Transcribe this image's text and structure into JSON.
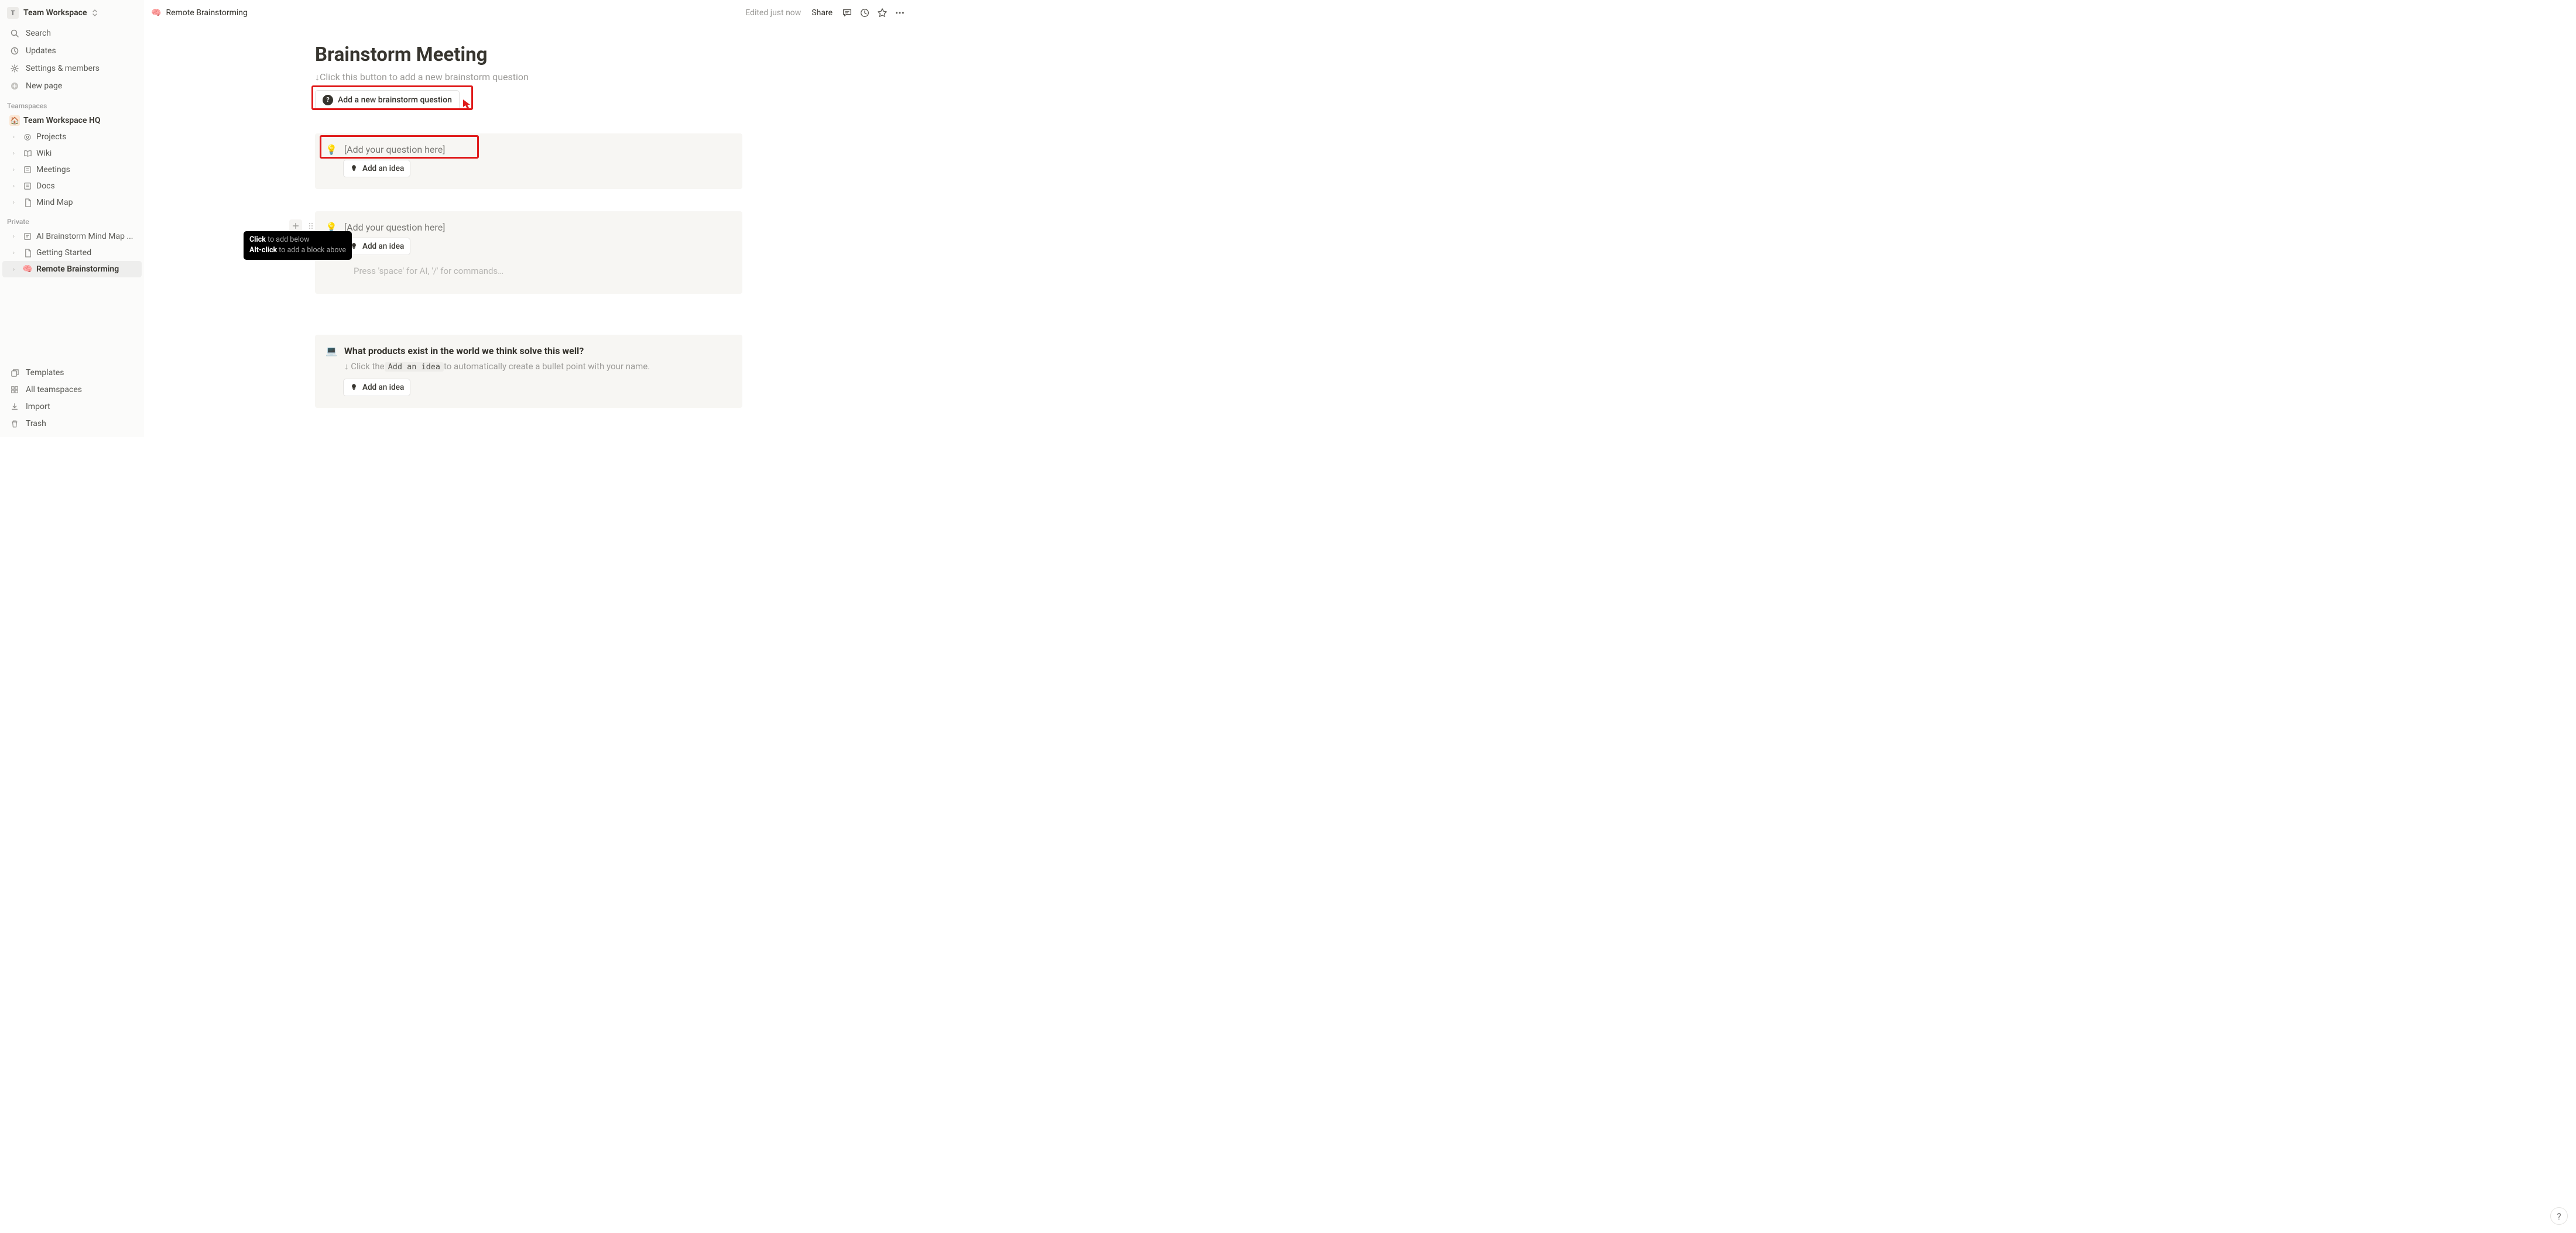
{
  "workspace": {
    "badge": "T",
    "name": "Team Workspace"
  },
  "sidebar_top": {
    "search": "Search",
    "updates": "Updates",
    "settings": "Settings & members",
    "new_page": "New page"
  },
  "sections": {
    "teamspaces": "Teamspaces",
    "private": "Private"
  },
  "teamspaces_root": "Team Workspace HQ",
  "teamspaces_items": [
    "Projects",
    "Wiki",
    "Meetings",
    "Docs",
    "Mind Map"
  ],
  "private_items": [
    "AI Brainstorm Mind Map ...",
    "Getting Started",
    "Remote Brainstorming"
  ],
  "sidebar_bottom": {
    "templates": "Templates",
    "all_teamspaces": "All teamspaces",
    "import": "Import",
    "trash": "Trash"
  },
  "breadcrumb": {
    "icon": "🧠",
    "label": "Remote Brainstorming"
  },
  "topbar": {
    "edited": "Edited just now",
    "share": "Share"
  },
  "page": {
    "title": "Brainstorm Meeting",
    "subtitle_prefix": "↓ ",
    "subtitle": "Click this button to add a new brainstorm question",
    "add_question_btn": "Add a new brainstorm question",
    "placeholder_question": "[Add your question here]",
    "add_idea_btn": "Add an idea",
    "empty_block_placeholder": "Press 'space' for AI, '/' for commands…",
    "tooltip_click": "Click",
    "tooltip_click_suffix": " to add below",
    "tooltip_alt": "Alt-click",
    "tooltip_alt_suffix": " to add a block above",
    "q2_icon": "💻",
    "q2_title": "What products exist in the world we think solve this well?",
    "q2_hint_prefix": "↓ Click the ",
    "q2_hint_inline": "Add an idea",
    "q2_hint_suffix": " to automatically create a bullet point with your name."
  },
  "help": "?"
}
